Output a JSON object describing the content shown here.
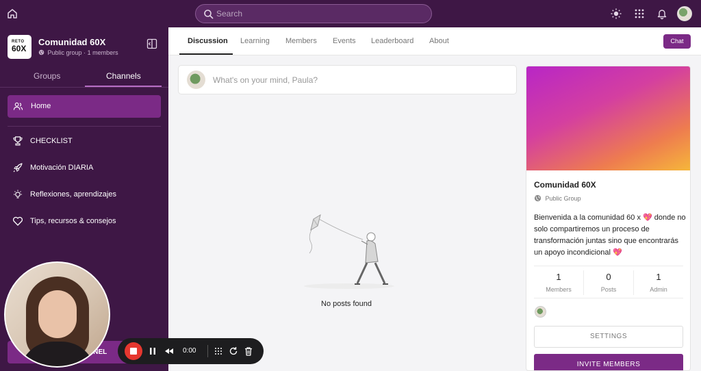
{
  "topbar": {
    "search_placeholder": "Search",
    "icons": [
      "home-icon",
      "search-icon",
      "sun-icon",
      "apps-grid-icon",
      "bell-icon",
      "avatar"
    ]
  },
  "sidebar": {
    "group_name": "Comunidad 60X",
    "group_visibility": "Public group",
    "group_members": "1 members",
    "logo_line1": "RETO",
    "logo_line2": "60X",
    "tabs": [
      {
        "label": "Groups",
        "active": false
      },
      {
        "label": "Channels",
        "active": true
      }
    ],
    "home_label": "Home",
    "channels": [
      {
        "label": "CHECKLIST",
        "icon": "trophy-icon"
      },
      {
        "label": "Motivación DIARIA",
        "icon": "rocket-icon"
      },
      {
        "label": "Reflexiones, aprendizajes",
        "icon": "lightbulb-icon"
      },
      {
        "label": "Tips, recursos & consejos",
        "icon": "heart-icon"
      }
    ],
    "new_channel_label": "NNEL"
  },
  "nav": {
    "tabs": [
      {
        "label": "Discussion",
        "active": true
      },
      {
        "label": "Learning",
        "active": false
      },
      {
        "label": "Members",
        "active": false
      },
      {
        "label": "Events",
        "active": false
      },
      {
        "label": "Leaderboard",
        "active": false
      },
      {
        "label": "About",
        "active": false
      }
    ],
    "chat_label": "Chat"
  },
  "composer": {
    "placeholder": "What's on your mind, Paula?"
  },
  "feed": {
    "empty_text": "No posts found"
  },
  "group_card": {
    "title": "Comunidad 60X",
    "type": "Public Group",
    "description": "Bienvenida a la comunidad 60 x 💖 donde no solo compartiremos un proceso de transformación juntas sino que encontrarás un apoyo incondicional 💖",
    "stats": [
      {
        "value": "1",
        "label": "Members"
      },
      {
        "value": "0",
        "label": "Posts"
      },
      {
        "value": "1",
        "label": "Admin"
      }
    ],
    "settings_label": "SETTINGS",
    "invite_label": "INVITE MEMBERS"
  },
  "recorder": {
    "time": "0:00"
  },
  "colors": {
    "brand_dark": "#3e1745",
    "brand_accent": "#7b2a86",
    "recording": "#e5372f"
  }
}
